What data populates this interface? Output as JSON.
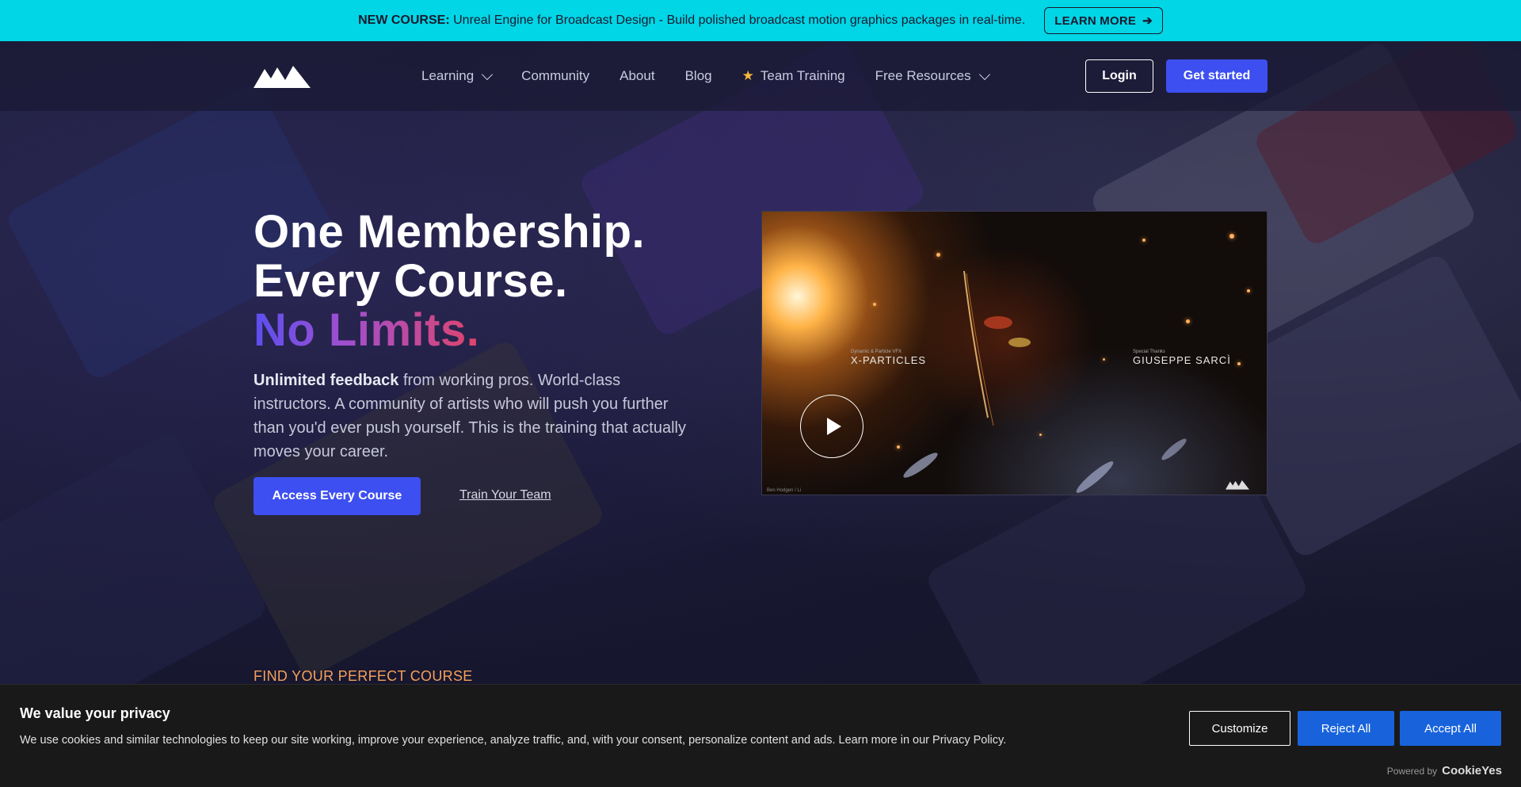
{
  "announcement": {
    "label": "NEW COURSE:",
    "text": "Unreal Engine for Broadcast Design - Build polished broadcast motion graphics packages in real-time.",
    "cta": "LEARN MORE",
    "cta_arrow": "➔"
  },
  "nav": {
    "items": [
      {
        "label": "Learning",
        "dropdown": true
      },
      {
        "label": "Community"
      },
      {
        "label": "About"
      },
      {
        "label": "Blog"
      },
      {
        "label": "Team Training",
        "icon": "star-icon"
      },
      {
        "label": "Free Resources",
        "dropdown": true
      }
    ],
    "login": "Login",
    "get_started": "Get started"
  },
  "hero": {
    "line1": "One Membership.",
    "line2": "Every Course.",
    "line3": "No Limits.",
    "sub_bold": "Unlimited feedback",
    "sub_rest": " from working pros. World-class instructors. A community of artists who will push you further than you'd ever push yourself. This is the training that actually moves your career.",
    "primary_cta": "Access Every Course",
    "secondary_cta": "Train Your Team"
  },
  "video": {
    "credit_left_small": "Dynamic & Particle VFX",
    "credit_left": "X-PARTICLES",
    "credit_right_small": "Special Thanks",
    "credit_right": "GIUSEPPE SARCÌ",
    "caption": "Ben Hodgen / Li"
  },
  "section_label": "FIND YOUR PERFECT COURSE",
  "cookie": {
    "title": "We value your privacy",
    "text": "We use cookies and similar technologies to keep our site working, improve your experience, analyze traffic, and, with your consent, personalize content and ads. Learn more in our Privacy Policy.",
    "customize": "Customize",
    "reject": "Reject All",
    "accept": "Accept All",
    "powered_by": "Powered by",
    "brand": "CookieYes"
  },
  "colors": {
    "announce_bg": "#00d6e6",
    "primary": "#3d4ff0",
    "cookie_btn": "#1863dc",
    "accent_orange": "#f5a05a"
  }
}
